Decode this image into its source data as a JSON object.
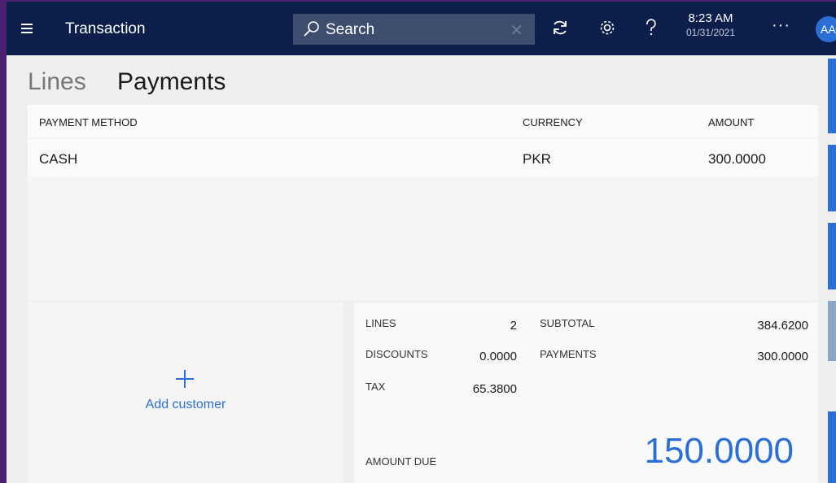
{
  "header": {
    "title": "Transaction",
    "search_placeholder": "Search",
    "time": "8:23 AM",
    "date": "01/31/2021",
    "more": "···",
    "avatar_initials": "AA"
  },
  "tabs": [
    {
      "label": "Lines",
      "active": false
    },
    {
      "label": "Payments",
      "active": true
    }
  ],
  "payments_table": {
    "columns": [
      "PAYMENT METHOD",
      "CURRENCY",
      "AMOUNT"
    ],
    "rows": [
      {
        "method": "CASH",
        "currency": "PKR",
        "amount": "300.0000"
      }
    ]
  },
  "customer": {
    "add_label": "Add customer"
  },
  "totals": {
    "lines_label": "LINES",
    "lines_value": "2",
    "discounts_label": "DISCOUNTS",
    "discounts_value": "0.0000",
    "tax_label": "TAX",
    "tax_value": "65.3800",
    "subtotal_label": "SUBTOTAL",
    "subtotal_value": "384.6200",
    "payments_label": "PAYMENTS",
    "payments_value": "300.0000",
    "amount_due_label": "AMOUNT DUE",
    "amount_due_value": "150.0000"
  },
  "colors": {
    "header_bg": "#0c1e4a",
    "accent": "#2b6fd6",
    "window_frame": "#4b1f6f"
  },
  "icons": [
    "menu-icon",
    "search-icon",
    "clear-icon",
    "refresh-icon",
    "settings-icon",
    "help-icon",
    "more-icon"
  ]
}
